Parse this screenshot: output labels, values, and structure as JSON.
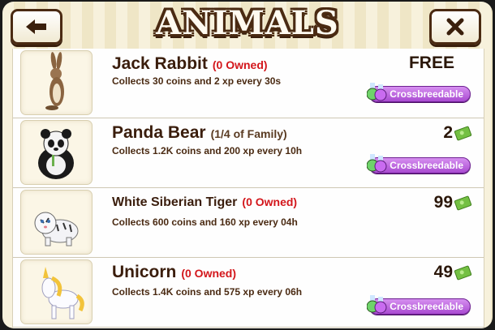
{
  "header": {
    "title": "ANIMALS",
    "back_icon": "arrow-left-icon",
    "close_icon": "close-x-icon"
  },
  "colors": {
    "owned_red": "#d3161b",
    "badge_purple": "#a94bd1",
    "header_brown": "#4a2a12",
    "cash_green": "#74c043"
  },
  "animals": [
    {
      "name": "Jack Rabbit",
      "owned": "(0 Owned)",
      "desc": "Collects 30 coins and 2 xp every 30s",
      "price": "FREE",
      "currency_icon": "",
      "badge": "Crossbreedable",
      "image": "jack-rabbit"
    },
    {
      "name": "Panda Bear",
      "owned": "(1/4 of Family)",
      "desc": "Collects 1.2K coins and 200 xp every 10h",
      "price": "2",
      "currency_icon": "cash-bill-icon",
      "badge": "Crossbreedable",
      "image": "panda-bear"
    },
    {
      "name": "White Siberian Tiger",
      "owned": "(0 Owned)",
      "desc": "Collects 600 coins and 160 xp every 04h",
      "price": "99",
      "currency_icon": "cash-bill-icon",
      "badge": "",
      "image": "white-siberian-tiger"
    },
    {
      "name": "Unicorn",
      "owned": "(0 Owned)",
      "desc": "Collects 1.4K coins and 575 xp every 06h",
      "price": "49",
      "currency_icon": "cash-bill-icon",
      "badge": "Crossbreedable",
      "image": "unicorn"
    }
  ]
}
